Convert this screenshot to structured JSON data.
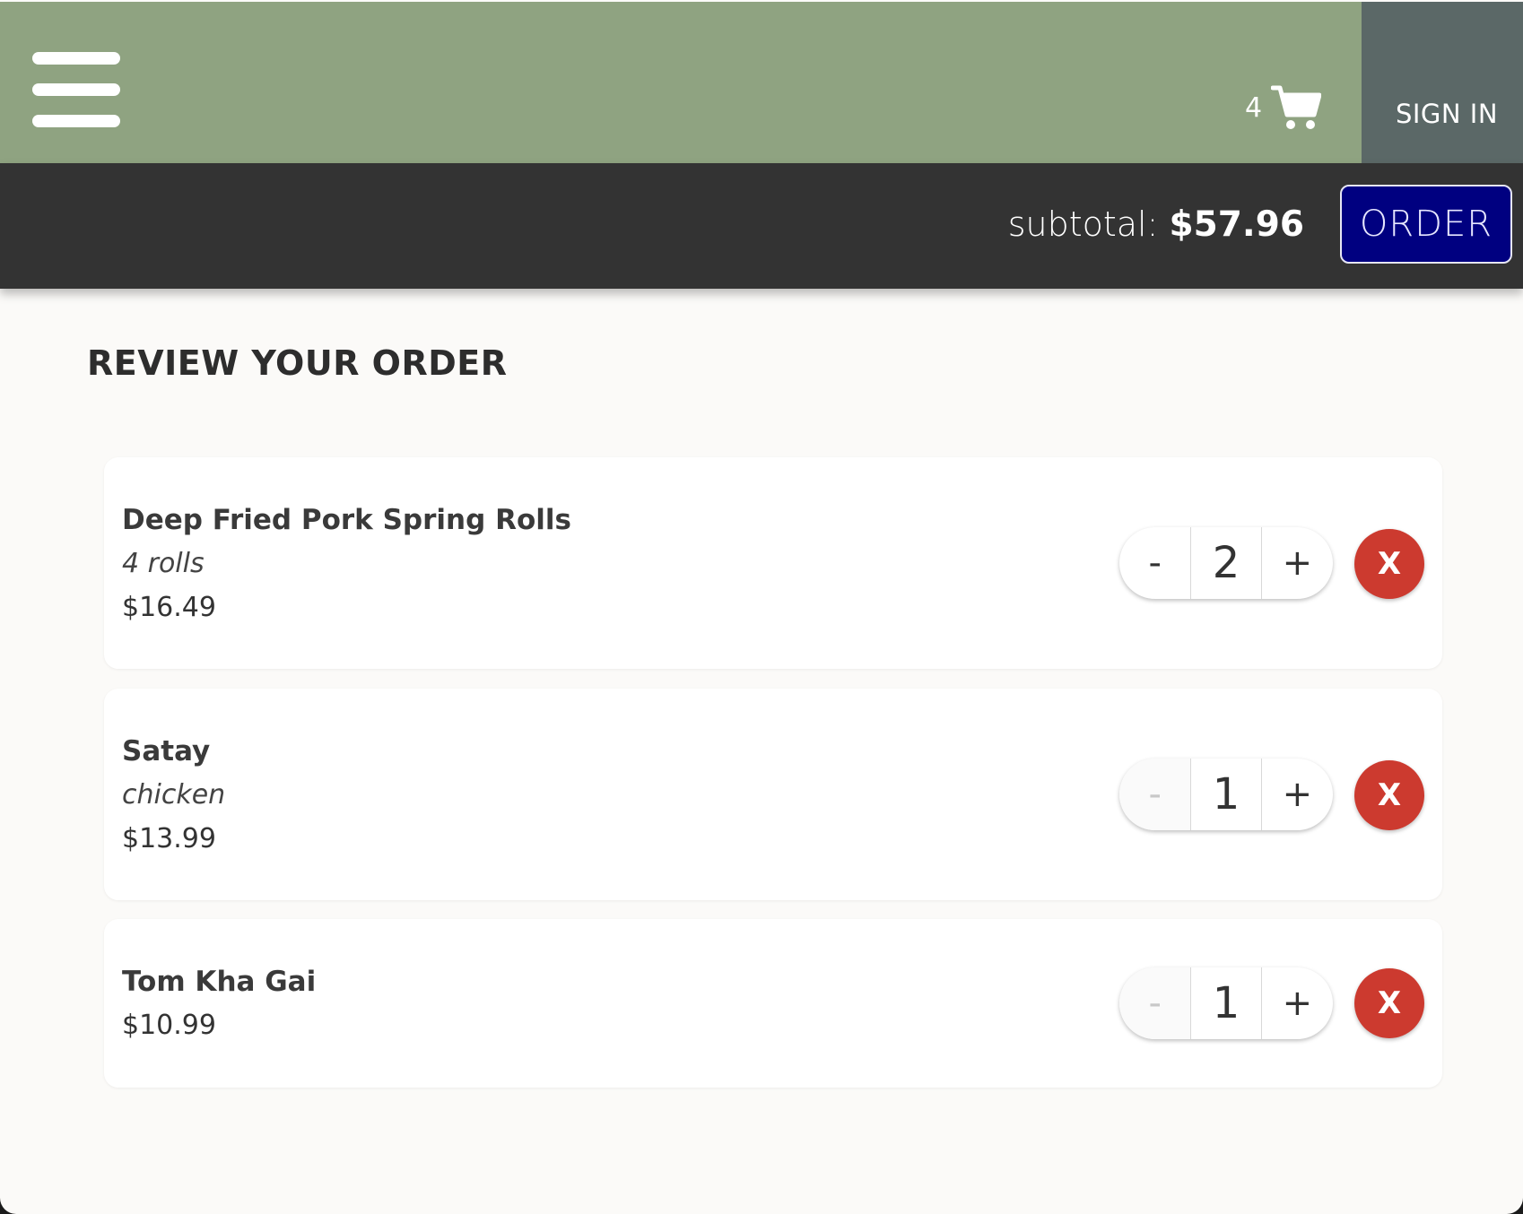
{
  "header": {
    "cart_count": "4",
    "cart_icon": "shopping-cart-icon",
    "menu_icon": "hamburger-menu-icon",
    "sign_in_label": "SIGN IN",
    "colors": {
      "topbar": "#8fa381",
      "signin_bg": "#5b6867",
      "orderbar": "#333333",
      "order_button": "#000080",
      "remove_button": "#cc3a2f"
    }
  },
  "order_bar": {
    "subtotal_label": "subtotal:",
    "subtotal_value": "$57.96",
    "order_label": "ORDER"
  },
  "page": {
    "title": "REVIEW YOUR ORDER"
  },
  "items": [
    {
      "name": "Deep Fried Pork Spring Rolls",
      "variant": "4 rolls",
      "price": "$16.49",
      "quantity": "2",
      "minus_label": "-",
      "plus_label": "+",
      "remove_label": "X"
    },
    {
      "name": "Satay",
      "variant": "chicken",
      "price": "$13.99",
      "quantity": "1",
      "minus_label": "-",
      "plus_label": "+",
      "remove_label": "X"
    },
    {
      "name": "Tom Kha Gai",
      "price": "$10.99",
      "quantity": "1",
      "minus_label": "-",
      "plus_label": "+",
      "remove_label": "X"
    }
  ]
}
